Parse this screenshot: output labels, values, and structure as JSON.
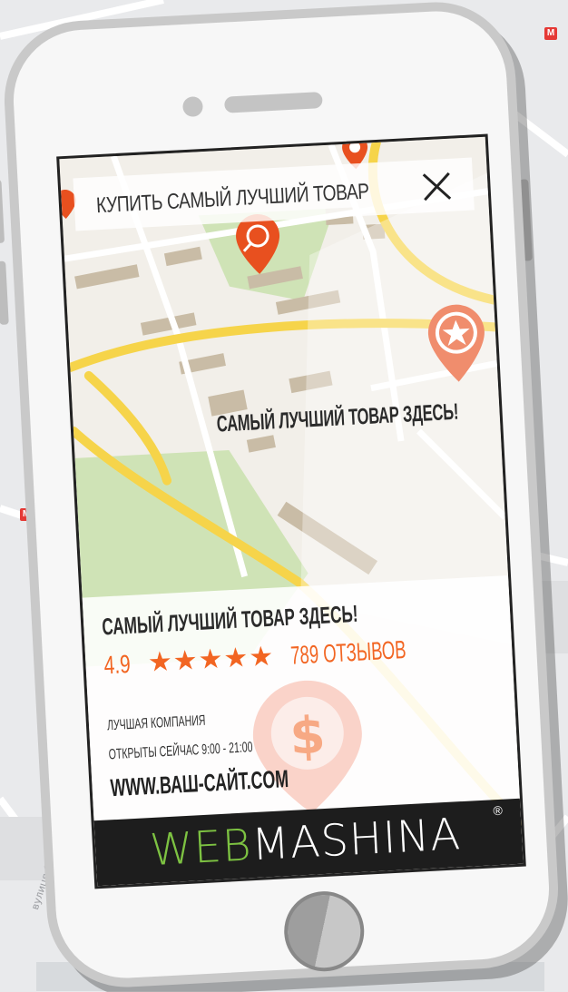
{
  "background_map": {
    "labels": [
      "вулиця Євгена Котляра"
    ]
  },
  "search": {
    "query": "КУПИТЬ САМЫЙ ЛУЧШИЙ ТОВАР",
    "close_icon": "close-icon"
  },
  "map": {
    "callout": "САМЫЙ ЛУЧШИЙ ТОВАР ЗДЕСЬ!"
  },
  "card": {
    "title": "САМЫЙ ЛУЧШИЙ ТОВАР ЗДЕСЬ!",
    "rating": "4.9",
    "stars": "★★★★★",
    "star_count": 5,
    "reviews": "789 ОТЗЫВОВ",
    "company": "ЛУЧШАЯ КОМПАНИЯ",
    "hours": "ОТКРЫТЫ СЕЙЧАС 9:00 - 21:00",
    "website": "WWW.ВАШ-САЙТ.COM"
  },
  "brand": {
    "part1": "WEB",
    "part2": "MASHINA",
    "reg": "®"
  },
  "colors": {
    "accent": "#f26522",
    "pin": "#e8501f",
    "brand_green": "#7dc242",
    "road": "#f6d44a",
    "brand_bar": "#1d1d1d"
  }
}
